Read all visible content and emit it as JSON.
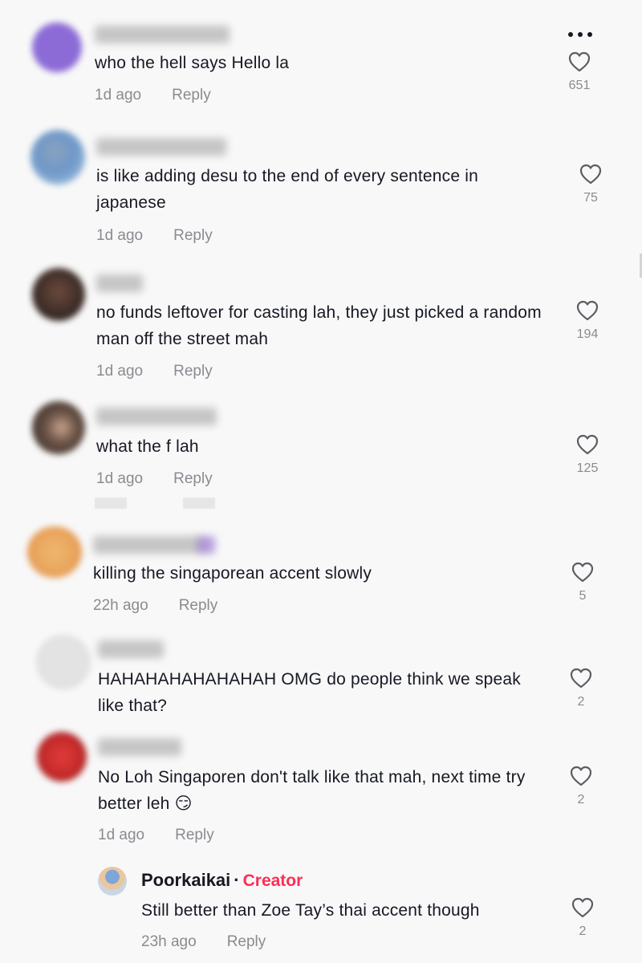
{
  "menu": {
    "icon": "more-options-icon"
  },
  "comments": [
    {
      "text": "who the hell says Hello la",
      "time": "1d ago",
      "reply": "Reply",
      "likes": "651",
      "avatar_color": "#8c6bd6"
    },
    {
      "text": "is like adding desu to the end of every sentence in japanese",
      "time": "1d ago",
      "reply": "Reply",
      "likes": "75",
      "avatar_color": "#6f98c8"
    },
    {
      "text": "no funds leftover for casting lah, they just picked a random man off the street mah",
      "time": "1d ago",
      "reply": "Reply",
      "likes": "194",
      "avatar_color": "#3a2b26"
    },
    {
      "text": "what the f lah",
      "time": "1d ago",
      "reply": "Reply",
      "likes": "125",
      "avatar_color": "#4a3a33"
    },
    {
      "text": "killing the singaporean accent slowly",
      "time": "22h ago",
      "reply": "Reply",
      "likes": "5",
      "avatar_color": "#e9a55c"
    },
    {
      "text": "HAHAHAHAHAHAHAH OMG do people think we speak like that?",
      "time": "",
      "reply": "",
      "likes": "2",
      "avatar_color": "#e3e3e3"
    },
    {
      "text": "No Loh Singaporen don't talk like that mah, next time try better leh 😏",
      "time": "1d ago",
      "reply": "Reply",
      "likes": "2",
      "avatar_color": "#c42a2a"
    }
  ],
  "creator_reply": {
    "name": "Poorkaikai",
    "separator": "·",
    "tag": "Creator",
    "text": "Still better than Zoe Tay’s thai accent though",
    "time": "23h ago",
    "reply": "Reply",
    "likes": "2"
  },
  "colors": {
    "accent": "#fe2c55",
    "muted": "#8a8b91",
    "text": "#161823"
  }
}
